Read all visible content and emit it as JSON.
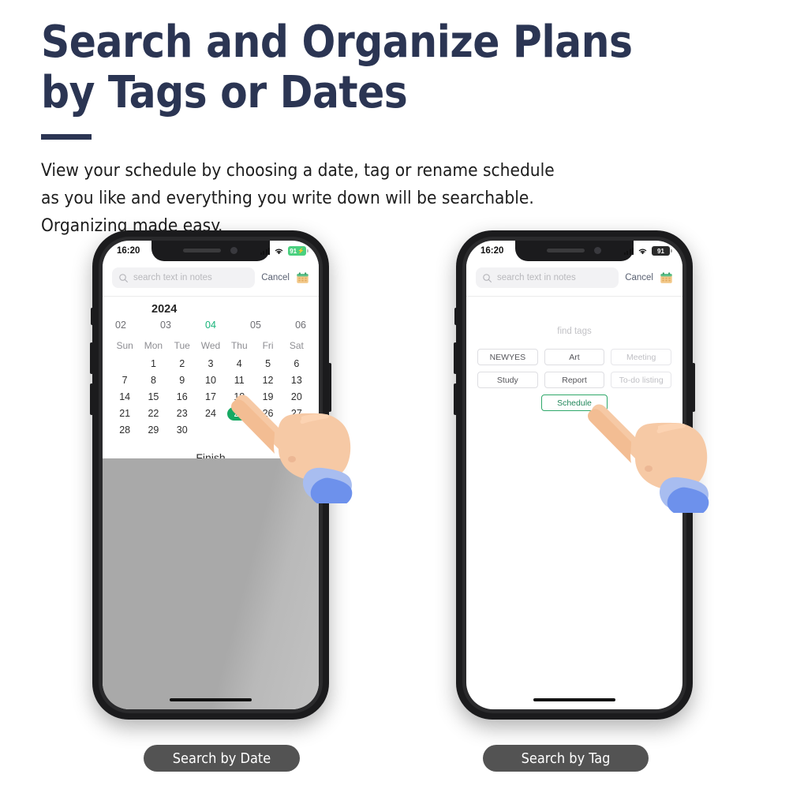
{
  "header": {
    "headline": "Search and Organize Plans\nby Tags or Dates",
    "subtext": "View your schedule by choosing a date, tag or rename schedule\nas you like and everything you write down will be searchable.\nOrganizing made easy."
  },
  "colors": {
    "headline_navy": "#2b3553",
    "accent_green": "#17a963",
    "month_active_green": "#18b37a",
    "chip_active_green": "#21875a",
    "battery_charging_green": "#4ad07f",
    "caption_gray": "#535353",
    "backdrop_gray": "#a9a9a9"
  },
  "phone_left": {
    "status": {
      "time": "16:20",
      "signal_icon": "signal-bars-icon",
      "wifi_icon": "wifi-icon",
      "battery_level": "91",
      "battery_charging": true,
      "battery_bolt": "⚡"
    },
    "search": {
      "icon": "search-icon",
      "placeholder": "search text in notes",
      "value": "",
      "cancel_label": "Cancel",
      "calendar_icon": "calendar-icon"
    },
    "calendar": {
      "year": "2024",
      "months": [
        "02",
        "03",
        "04",
        "05",
        "06"
      ],
      "active_month": "04",
      "weekdays": [
        "Sun",
        "Mon",
        "Tue",
        "Wed",
        "Thu",
        "Fri",
        "Sat"
      ],
      "weeks": [
        [
          "",
          "1",
          "2",
          "3",
          "4",
          "5",
          "6"
        ],
        [
          "7",
          "8",
          "9",
          "10",
          "11",
          "12",
          "13"
        ],
        [
          "14",
          "15",
          "16",
          "17",
          "18",
          "19",
          "20"
        ],
        [
          "21",
          "22",
          "23",
          "24",
          "25",
          "26",
          "27"
        ],
        [
          "28",
          "29",
          "30",
          "",
          "",
          "",
          ""
        ]
      ],
      "selected_day": "25",
      "finish_label": "Finish"
    },
    "hand_icon": "pointing-hand-cursor",
    "caption": "Search by Date"
  },
  "phone_right": {
    "status": {
      "time": "16:20",
      "signal_icon": "signal-bars-icon",
      "wifi_icon": "wifi-icon",
      "battery_level": "91",
      "battery_charging": false
    },
    "search": {
      "icon": "search-icon",
      "placeholder": "search text in notes",
      "value": "",
      "cancel_label": "Cancel",
      "calendar_icon": "calendar-icon"
    },
    "tags": {
      "title": "find tags",
      "rows": [
        [
          {
            "label": "NEWYES",
            "state": "normal"
          },
          {
            "label": "Art",
            "state": "normal"
          },
          {
            "label": "Meeting",
            "state": "muted"
          }
        ],
        [
          {
            "label": "Study",
            "state": "normal"
          },
          {
            "label": "Report",
            "state": "normal"
          },
          {
            "label": "To-do listing",
            "state": "muted"
          }
        ],
        [
          {
            "label": "Schedule",
            "state": "active"
          }
        ]
      ]
    },
    "hand_icon": "pointing-hand-cursor",
    "caption": "Search by Tag"
  }
}
